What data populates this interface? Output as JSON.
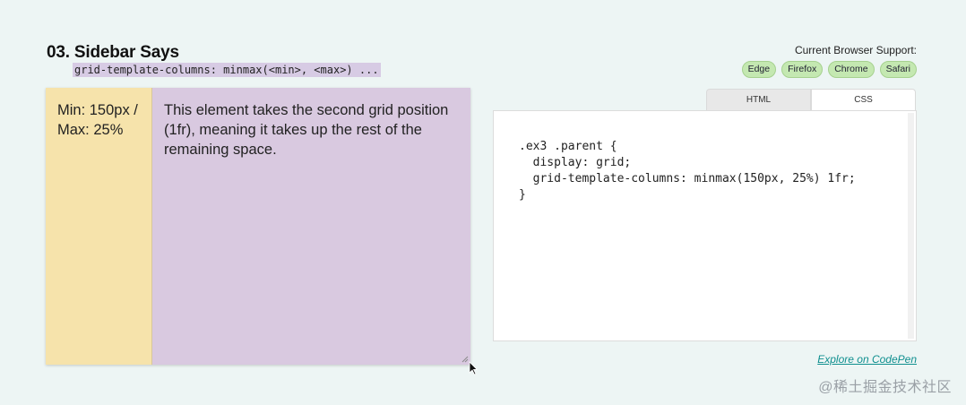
{
  "header": {
    "title": "03. Sidebar Says",
    "subtitle_code": "grid-template-columns: minmax(<min>, <max>) ..."
  },
  "demo": {
    "first_column": "Min: 150px / Max: 25%",
    "second_column": "This element takes the second grid position (1fr), meaning it takes up the rest of the remaining space.",
    "colors": {
      "first": "#f6e3ab",
      "second": "#d9c9e0"
    }
  },
  "browser_support": {
    "label": "Current Browser Support:",
    "browsers": [
      "Edge",
      "Firefox",
      "Chrome",
      "Safari"
    ],
    "badge_color": "#c4e8b1"
  },
  "editor": {
    "tabs": [
      {
        "label": "HTML",
        "active": false
      },
      {
        "label": "CSS",
        "active": true
      }
    ],
    "code": ".ex3 .parent {\n  display: grid;\n  grid-template-columns: minmax(150px, 25%) 1fr;\n}"
  },
  "codepen_link": "Explore on CodePen",
  "watermark": "@稀土掘金技术社区"
}
